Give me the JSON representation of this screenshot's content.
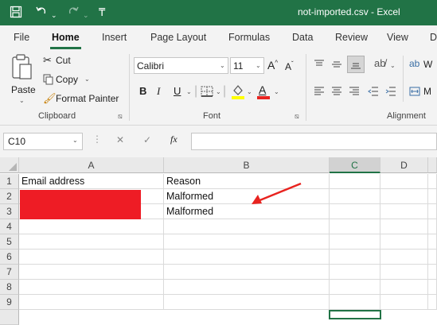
{
  "titlebar": {
    "title": "not-imported.csv  -  Excel",
    "icons": [
      "save-icon",
      "undo-icon",
      "redo-icon",
      "customize-qat-icon"
    ]
  },
  "tabs": [
    "File",
    "Home",
    "Insert",
    "Page Layout",
    "Formulas",
    "Data",
    "Review",
    "View",
    "D"
  ],
  "active_tab": "Home",
  "ribbon": {
    "clipboard": {
      "paste": "Paste",
      "cut": "Cut",
      "copy": "Copy",
      "format_painter": "Format Painter",
      "group_label": "Clipboard"
    },
    "font": {
      "font_name": "Calibri",
      "font_size": "11",
      "bold": "B",
      "italic": "I",
      "underline": "U",
      "grow": "A",
      "shrink": "A",
      "font_color": "A",
      "group_label": "Font"
    },
    "alignment": {
      "wrap": "W",
      "merge": "M",
      "group_label": "Alignment"
    }
  },
  "formula_bar": {
    "name_box": "C10",
    "fx": "fx",
    "cancel": "✕",
    "enter": "✓",
    "formula": ""
  },
  "sheet": {
    "columns": [
      "A",
      "B",
      "C",
      "D"
    ],
    "selected_column": "C",
    "rows": [
      "1",
      "2",
      "3",
      "4",
      "5",
      "6",
      "7",
      "8",
      "9"
    ],
    "cells": {
      "A1": "Email address",
      "B1": "Reason",
      "B2": "Malformed",
      "B3": "Malformed"
    },
    "redaction_color": "#ee1c25",
    "arrow_color": "#e8231f"
  },
  "colors": {
    "accent": "#217346",
    "ribbon_bg": "#f3f3f3"
  }
}
